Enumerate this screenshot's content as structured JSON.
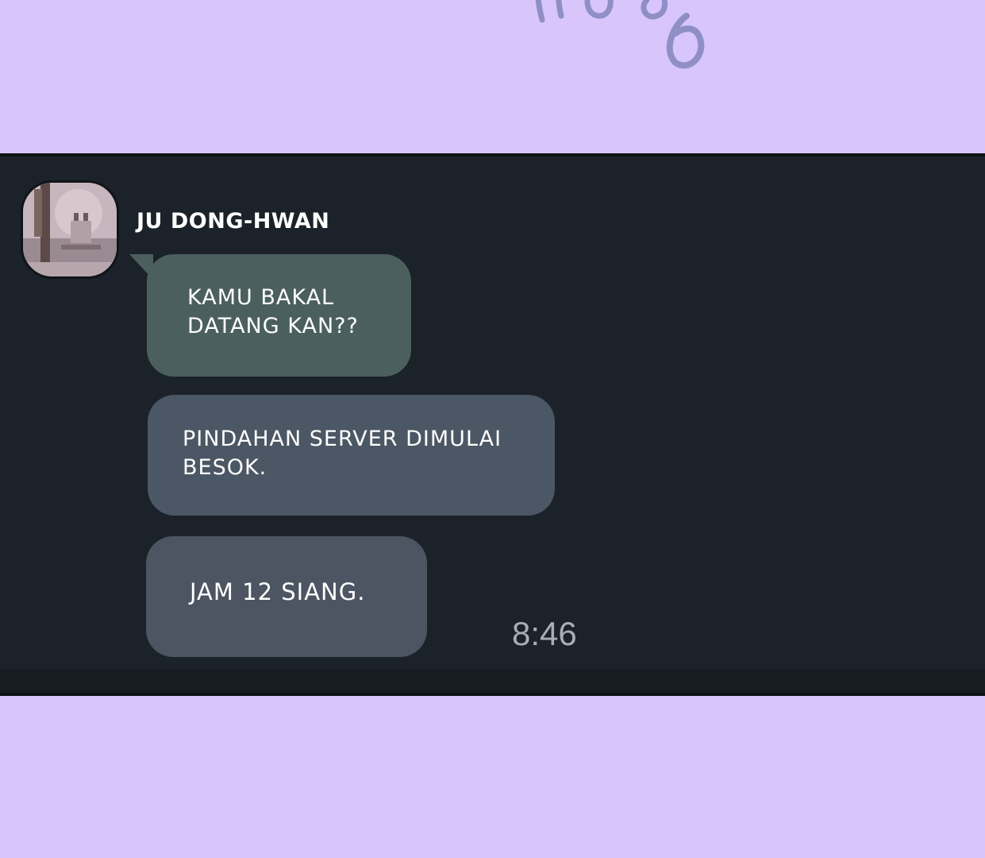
{
  "chat": {
    "sender_name": "JU DONG-HWAN",
    "messages": [
      {
        "text_line1": "KAMU BAKAL",
        "text_line2": "DATANG KAN??"
      },
      {
        "text_line1": "PINDAHAN SERVER DIMULAI",
        "text_line2": "BESOK."
      },
      {
        "text_line1": "JAM 12 SIANG."
      }
    ],
    "timestamp": "8:46"
  },
  "colors": {
    "background": "#d7c5fb",
    "chat_panel": "#1b2229",
    "bubble_first": "#4b5f5e",
    "bubble_other": "#4b5764",
    "timestamp_text": "#a9aeb3"
  },
  "icons": {
    "avatar": "profile-photo"
  }
}
